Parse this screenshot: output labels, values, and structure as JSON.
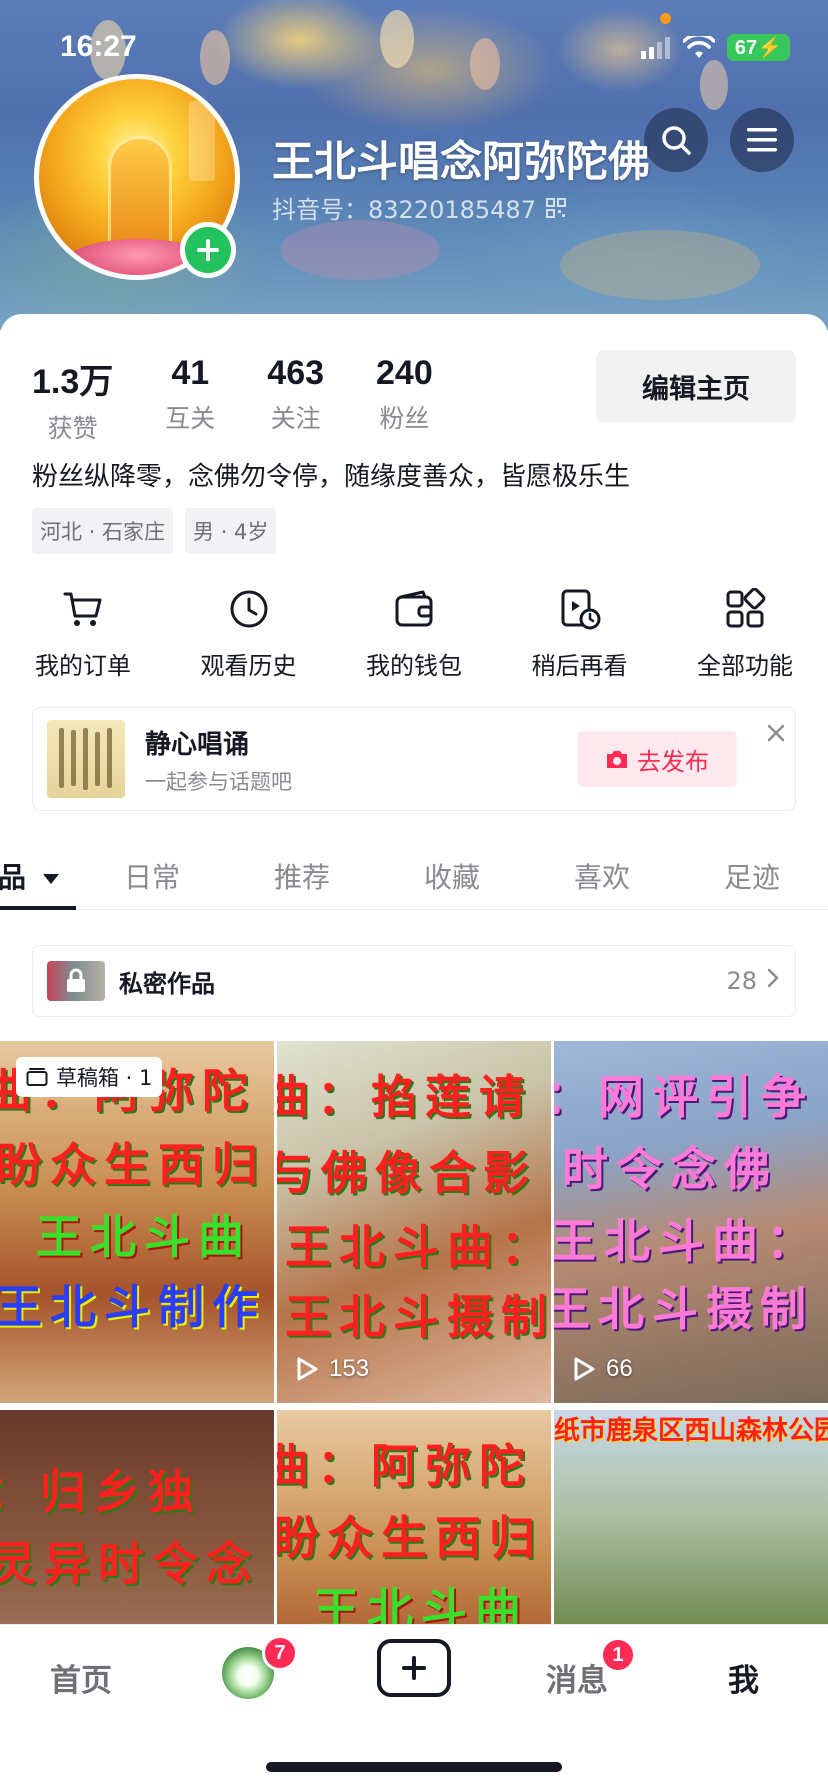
{
  "status_bar": {
    "time": "16:27",
    "battery": "67"
  },
  "profile": {
    "nickname": "王北斗唱念阿弥陀佛",
    "douyin_id": "抖音号：83220185487",
    "bio": "粉丝纵降零，念佛勿令停，随缘度善众，皆愿极乐生",
    "tags": [
      "河北 · 石家庄",
      "男 · 4岁"
    ],
    "edit_label": "编辑主页"
  },
  "stats": [
    {
      "value": "1.3万",
      "label": "获赞"
    },
    {
      "value": "41",
      "label": "互关"
    },
    {
      "value": "463",
      "label": "关注"
    },
    {
      "value": "240",
      "label": "粉丝"
    }
  ],
  "quick_actions": [
    {
      "label": "我的订单",
      "icon": "cart-icon"
    },
    {
      "label": "观看历史",
      "icon": "clock-icon"
    },
    {
      "label": "我的钱包",
      "icon": "wallet-icon"
    },
    {
      "label": "稍后再看",
      "icon": "watch-later-icon"
    },
    {
      "label": "全部功能",
      "icon": "grid-apps-icon"
    }
  ],
  "topic_card": {
    "title": "静心唱诵",
    "subtitle": "一起参与话题吧",
    "publish_label": "去发布"
  },
  "tabs": [
    "作品",
    "日常",
    "推荐",
    "收藏",
    "喜欢",
    "足迹"
  ],
  "private_works": {
    "label": "私密作品",
    "count": "28"
  },
  "videos": [
    {
      "lines": [
        "曲：阿弥陀",
        "盼众生西归",
        "王北斗曲",
        "王北斗制作"
      ],
      "draft_label": "草稿箱 · 1",
      "plays": ""
    },
    {
      "lines": [
        "曲：掐莲请",
        "与佛像合影",
        "王北斗曲：",
        "王北斗摄制"
      ],
      "draft_label": "",
      "plays": "153"
    },
    {
      "lines": [
        "：网评引争",
        "时令念佛",
        "王北斗曲：",
        "王北斗摄制"
      ],
      "draft_label": "",
      "plays": "66"
    },
    {
      "lines": [
        "：归乡独",
        "灵异时令念"
      ],
      "draft_label": "",
      "plays": ""
    },
    {
      "lines": [
        "曲：阿弥陀",
        "盼众生西归",
        "王北斗曲"
      ],
      "draft_label": "",
      "plays": ""
    },
    {
      "lines": [
        "纸市鹿泉区西山森林公园"
      ],
      "draft_label": "",
      "plays": ""
    }
  ],
  "bottom_nav": {
    "home": "首页",
    "friends_badge": "7",
    "messages": "消息",
    "messages_badge": "1",
    "me": "我"
  },
  "colors": {
    "accent": "#fe2c55",
    "add_badge": "#24c25e",
    "battery": "#37c75b"
  }
}
